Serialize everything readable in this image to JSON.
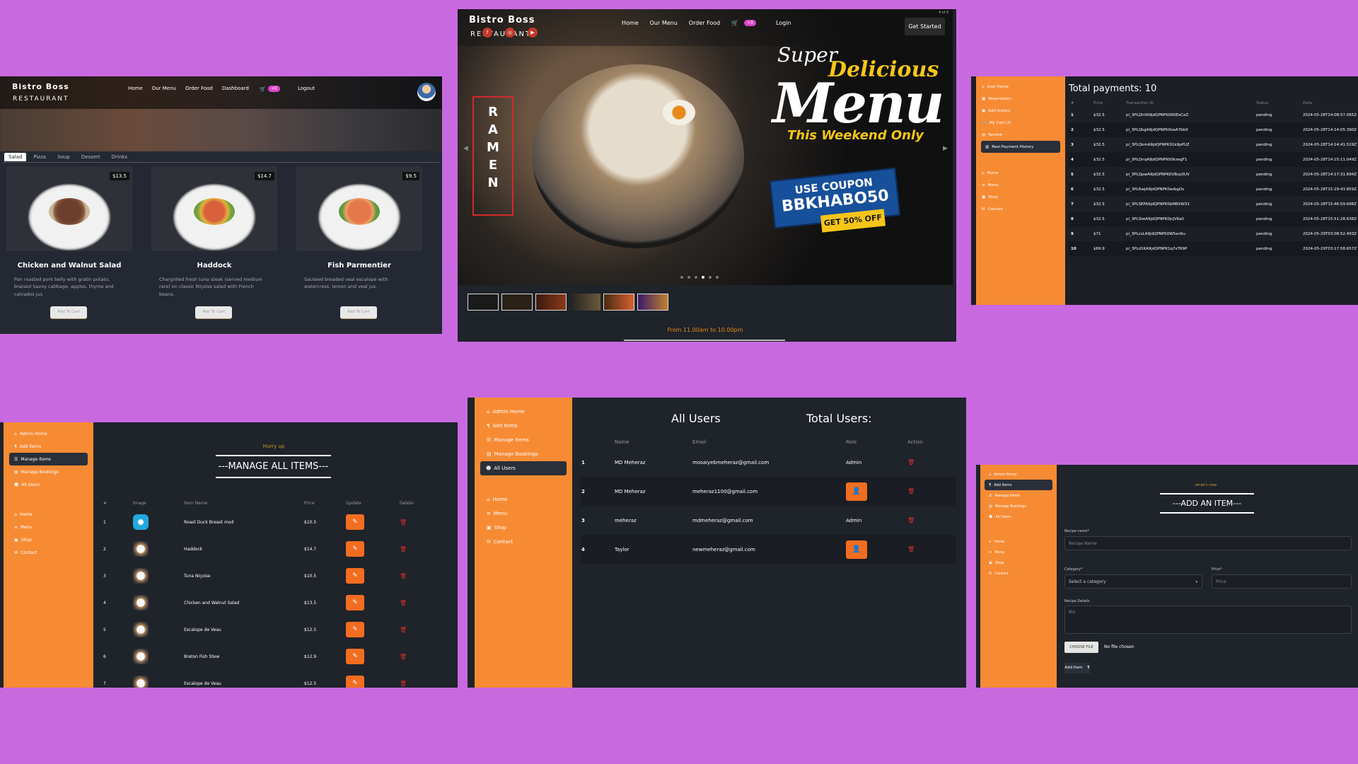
{
  "menu_page": {
    "brand": "Bistro Boss",
    "brand_sub": "RESTAURANT",
    "nav": [
      "Home",
      "Our Menu",
      "Order Food",
      "Dashboard"
    ],
    "cart_badge": "+0",
    "logout": "Logout",
    "tabs": [
      "Salad",
      "Pizza",
      "Soup",
      "Dessert",
      "Drinks"
    ],
    "active_tab": "Salad",
    "cards": [
      {
        "name": "Chicken and Walnut Salad",
        "price": "$13.5",
        "desc": "Pan roasted pork belly with gratin potato, braised Savoy cabbage, apples, thyme and calvados jus",
        "button": "Add To Cart"
      },
      {
        "name": "Haddock",
        "price": "$14.7",
        "desc": "Chargrilled fresh tuna steak (served medium rare) on classic Niçoise salad with French beans.",
        "button": "Add To Cart"
      },
      {
        "name": "Fish Parmentier",
        "price": "$9.5",
        "desc": "Sautéed breaded veal escalope with watercress, lemon and veal jus.",
        "button": "Add To Cart"
      }
    ]
  },
  "hero_page": {
    "brand": "Bistro Boss",
    "brand_sub": "RESTAURANT",
    "nav": [
      "Home",
      "Our Menu",
      "Order Food"
    ],
    "cart_badge": "+0",
    "login": "Login",
    "get_started": "Get Started",
    "slide_counter": "4 of 6",
    "side_word": "RAMEN",
    "banner": {
      "super": "Super",
      "delicious": "Delicious",
      "menu": "Menu",
      "weekend": "This Weekend Only",
      "coupon_l1": "USE COUPON",
      "coupon_l2": "BBKHABO50",
      "off": "GET 50% OFF"
    },
    "hours": "From 11.00am to 10.00pm"
  },
  "payments_page": {
    "sidebar": [
      "User Home",
      "Reservation",
      "Add history",
      "My Cart (2)",
      "Review",
      "Real Payment History",
      "Home",
      "Menu",
      "Shop",
      "Contact"
    ],
    "active_item": "Real Payment History",
    "title": "Total payments: 10",
    "columns": [
      "#",
      "Price",
      "Transaction ID",
      "Status",
      "Date"
    ],
    "rows": [
      [
        "1",
        "$32.5",
        "pi_3PLQhVA9jdQPNPK060EoCeZ",
        "pending",
        "2024-05-28T14:08:57.065Z"
      ],
      [
        "2",
        "$32.5",
        "pi_3PLQkgA9jdQPNPK0oeA7bbX",
        "pending",
        "2024-05-28T14:14:05.390Z"
      ],
      [
        "3",
        "$32.5",
        "pi_3PLQkmA9jdQPNPK01k9pPUZ",
        "pending",
        "2024-05-28T14:14:41.519Z"
      ],
      [
        "4",
        "$32.5",
        "pi_3PLQnqA9jdQPNPK00kzegF1",
        "pending",
        "2024-05-28T14:15:11.049Z"
      ],
      [
        "5",
        "$32.5",
        "pi_3PLQpwA9jdQPNPK0VBcp0UV",
        "pending",
        "2024-05-28T14:17:31.694Z"
      ],
      [
        "6",
        "$32.5",
        "pi_3PLRwjA9jdQPNPK0wibgOs",
        "pending",
        "2024-05-28T15:29:43.859Z"
      ],
      [
        "7",
        "$32.5",
        "pi_3PLSEFA9jdQPNPK0bMBXW31",
        "pending",
        "2024-05-28T15:46:59.698Z"
      ],
      [
        "8",
        "$32.5",
        "pi_3PLSIwA9jdQPNPK0jcJV6a0",
        "pending",
        "2024-05-28T15:51:28.638Z"
      ],
      [
        "9",
        "$71",
        "pi_3PLcsLA9jdQPNPK0W5an6u",
        "pending",
        "2024-05-29T03:08:52.493Z"
      ],
      [
        "10",
        "$69.9",
        "pi_3PLd1KA9jdQPNPK1q7sTR9P",
        "pending",
        "2024-05-29T03:17:58.657Z"
      ]
    ]
  },
  "manage_page": {
    "sidebar": [
      "Admin Home",
      "Add Items",
      "Manage Items",
      "Manage Bookings",
      "All Users",
      "Home",
      "Menu",
      "Shop",
      "Contact"
    ],
    "active_item": "Manage Items",
    "subtitle": "Hurry up",
    "title": "---MANAGE ALL ITEMS---",
    "columns": [
      "#",
      "Image",
      "Item Name",
      "Price",
      "Update",
      "Delete"
    ],
    "rows": [
      [
        "1",
        "Roast Duck Breast mod",
        "$10.5"
      ],
      [
        "2",
        "Haddock",
        "$14.7"
      ],
      [
        "3",
        "Tuna Niçoise",
        "$10.5"
      ],
      [
        "4",
        "Chicken and Walnut Salad",
        "$13.5"
      ],
      [
        "5",
        "Escalope de Veau",
        "$12.5"
      ],
      [
        "6",
        "Breton Fish Stew",
        "$12.9"
      ],
      [
        "7",
        "Escalope de Veau",
        "$12.5"
      ]
    ]
  },
  "users_page": {
    "sidebar": [
      "Admin Home",
      "Add Items",
      "Manage Items",
      "Manage Bookings",
      "All Users",
      "Home",
      "Menu",
      "Shop",
      "Contact"
    ],
    "active_item": "All Users",
    "title": "All Users",
    "total": "Total Users:",
    "columns": [
      "",
      "Name",
      "Email",
      "Role",
      "Action"
    ],
    "rows": [
      {
        "n": "1",
        "name": "MD Meheraz",
        "email": "mosaiyebmeheraz@gmail.com",
        "role": "Admin"
      },
      {
        "n": "2",
        "name": "MD Meheraz",
        "email": "meheraz1100@gmail.com",
        "role": ""
      },
      {
        "n": "3",
        "name": "meheraz",
        "email": "mdmeheraz@gmail.com",
        "role": "Admin"
      },
      {
        "n": "4",
        "name": "Taylor",
        "email": "newmeheraz@gmail.com",
        "role": ""
      }
    ]
  },
  "add_page": {
    "sidebar": [
      "Admin Home",
      "Add Items",
      "Manage Items",
      "Manage Bookings",
      "All Users",
      "Home",
      "Menu",
      "Shop",
      "Contact"
    ],
    "active_item": "Add Items",
    "subtitle": "what's new",
    "title": "---ADD AN ITEM---",
    "recipe_label": "Recipe name*",
    "recipe_placeholder": "Recipe Name",
    "category_label": "Category*",
    "category_value": "Select a category",
    "price_label": "Price*",
    "price_placeholder": "Price",
    "details_label": "Recipe Details",
    "details_placeholder": "Bio",
    "choose_file": "CHOOSE FILE",
    "no_file": "No file chosen",
    "add_button": "Add Item"
  }
}
